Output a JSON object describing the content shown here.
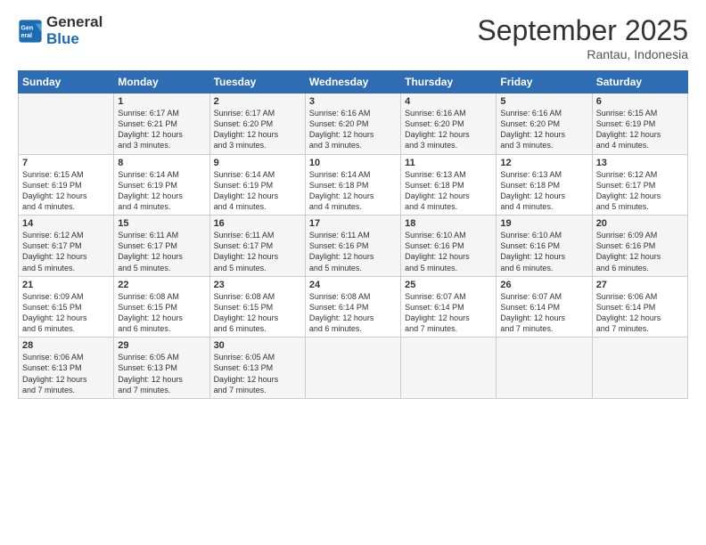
{
  "logo": {
    "line1": "General",
    "line2": "Blue"
  },
  "title": "September 2025",
  "subtitle": "Rantau, Indonesia",
  "days_of_week": [
    "Sunday",
    "Monday",
    "Tuesday",
    "Wednesday",
    "Thursday",
    "Friday",
    "Saturday"
  ],
  "weeks": [
    [
      {
        "day": "",
        "info": ""
      },
      {
        "day": "1",
        "info": "Sunrise: 6:17 AM\nSunset: 6:21 PM\nDaylight: 12 hours\nand 3 minutes."
      },
      {
        "day": "2",
        "info": "Sunrise: 6:17 AM\nSunset: 6:20 PM\nDaylight: 12 hours\nand 3 minutes."
      },
      {
        "day": "3",
        "info": "Sunrise: 6:16 AM\nSunset: 6:20 PM\nDaylight: 12 hours\nand 3 minutes."
      },
      {
        "day": "4",
        "info": "Sunrise: 6:16 AM\nSunset: 6:20 PM\nDaylight: 12 hours\nand 3 minutes."
      },
      {
        "day": "5",
        "info": "Sunrise: 6:16 AM\nSunset: 6:20 PM\nDaylight: 12 hours\nand 3 minutes."
      },
      {
        "day": "6",
        "info": "Sunrise: 6:15 AM\nSunset: 6:19 PM\nDaylight: 12 hours\nand 4 minutes."
      }
    ],
    [
      {
        "day": "7",
        "info": "Sunrise: 6:15 AM\nSunset: 6:19 PM\nDaylight: 12 hours\nand 4 minutes."
      },
      {
        "day": "8",
        "info": "Sunrise: 6:14 AM\nSunset: 6:19 PM\nDaylight: 12 hours\nand 4 minutes."
      },
      {
        "day": "9",
        "info": "Sunrise: 6:14 AM\nSunset: 6:19 PM\nDaylight: 12 hours\nand 4 minutes."
      },
      {
        "day": "10",
        "info": "Sunrise: 6:14 AM\nSunset: 6:18 PM\nDaylight: 12 hours\nand 4 minutes."
      },
      {
        "day": "11",
        "info": "Sunrise: 6:13 AM\nSunset: 6:18 PM\nDaylight: 12 hours\nand 4 minutes."
      },
      {
        "day": "12",
        "info": "Sunrise: 6:13 AM\nSunset: 6:18 PM\nDaylight: 12 hours\nand 4 minutes."
      },
      {
        "day": "13",
        "info": "Sunrise: 6:12 AM\nSunset: 6:17 PM\nDaylight: 12 hours\nand 5 minutes."
      }
    ],
    [
      {
        "day": "14",
        "info": "Sunrise: 6:12 AM\nSunset: 6:17 PM\nDaylight: 12 hours\nand 5 minutes."
      },
      {
        "day": "15",
        "info": "Sunrise: 6:11 AM\nSunset: 6:17 PM\nDaylight: 12 hours\nand 5 minutes."
      },
      {
        "day": "16",
        "info": "Sunrise: 6:11 AM\nSunset: 6:17 PM\nDaylight: 12 hours\nand 5 minutes."
      },
      {
        "day": "17",
        "info": "Sunrise: 6:11 AM\nSunset: 6:16 PM\nDaylight: 12 hours\nand 5 minutes."
      },
      {
        "day": "18",
        "info": "Sunrise: 6:10 AM\nSunset: 6:16 PM\nDaylight: 12 hours\nand 5 minutes."
      },
      {
        "day": "19",
        "info": "Sunrise: 6:10 AM\nSunset: 6:16 PM\nDaylight: 12 hours\nand 6 minutes."
      },
      {
        "day": "20",
        "info": "Sunrise: 6:09 AM\nSunset: 6:16 PM\nDaylight: 12 hours\nand 6 minutes."
      }
    ],
    [
      {
        "day": "21",
        "info": "Sunrise: 6:09 AM\nSunset: 6:15 PM\nDaylight: 12 hours\nand 6 minutes."
      },
      {
        "day": "22",
        "info": "Sunrise: 6:08 AM\nSunset: 6:15 PM\nDaylight: 12 hours\nand 6 minutes."
      },
      {
        "day": "23",
        "info": "Sunrise: 6:08 AM\nSunset: 6:15 PM\nDaylight: 12 hours\nand 6 minutes."
      },
      {
        "day": "24",
        "info": "Sunrise: 6:08 AM\nSunset: 6:14 PM\nDaylight: 12 hours\nand 6 minutes."
      },
      {
        "day": "25",
        "info": "Sunrise: 6:07 AM\nSunset: 6:14 PM\nDaylight: 12 hours\nand 7 minutes."
      },
      {
        "day": "26",
        "info": "Sunrise: 6:07 AM\nSunset: 6:14 PM\nDaylight: 12 hours\nand 7 minutes."
      },
      {
        "day": "27",
        "info": "Sunrise: 6:06 AM\nSunset: 6:14 PM\nDaylight: 12 hours\nand 7 minutes."
      }
    ],
    [
      {
        "day": "28",
        "info": "Sunrise: 6:06 AM\nSunset: 6:13 PM\nDaylight: 12 hours\nand 7 minutes."
      },
      {
        "day": "29",
        "info": "Sunrise: 6:05 AM\nSunset: 6:13 PM\nDaylight: 12 hours\nand 7 minutes."
      },
      {
        "day": "30",
        "info": "Sunrise: 6:05 AM\nSunset: 6:13 PM\nDaylight: 12 hours\nand 7 minutes."
      },
      {
        "day": "",
        "info": ""
      },
      {
        "day": "",
        "info": ""
      },
      {
        "day": "",
        "info": ""
      },
      {
        "day": "",
        "info": ""
      }
    ]
  ]
}
